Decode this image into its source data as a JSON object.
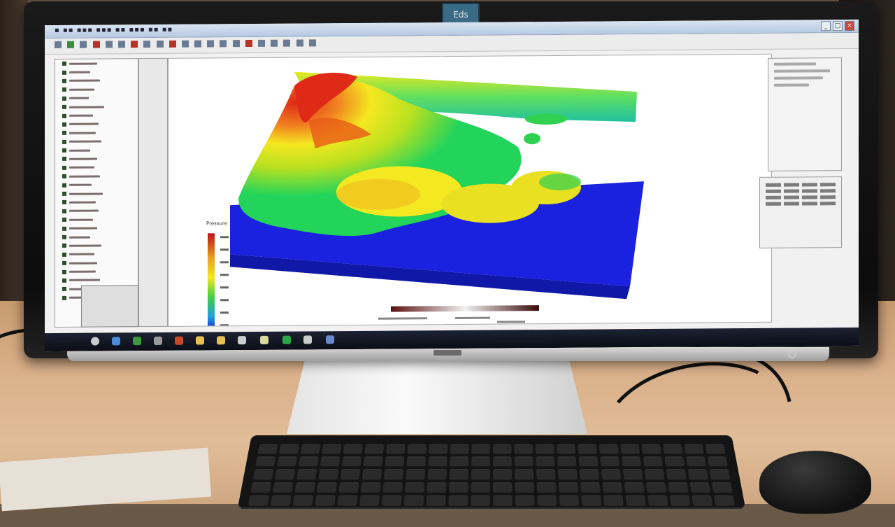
{
  "screen": {
    "logo_tab": "Eds",
    "legend_title": "Pressure",
    "colorbar_ticks": [
      "",
      "",
      "",
      "",
      "",
      "",
      "",
      "",
      ""
    ],
    "bottom_scale_labels": [],
    "tray_text": ""
  },
  "colors": {
    "terrain_low": "#1a22e0",
    "terrain_mid_green": "#22d45a",
    "terrain_mid_yellow": "#f4e820",
    "terrain_high": "#e02a18",
    "desk": "#d9b08a",
    "monitor_bezel": "#111111"
  },
  "icons": [
    "window-close-icon",
    "window-maximize-icon",
    "window-minimize-icon",
    "start-icon",
    "browser-icon",
    "folder-icon",
    "app-icon"
  ]
}
